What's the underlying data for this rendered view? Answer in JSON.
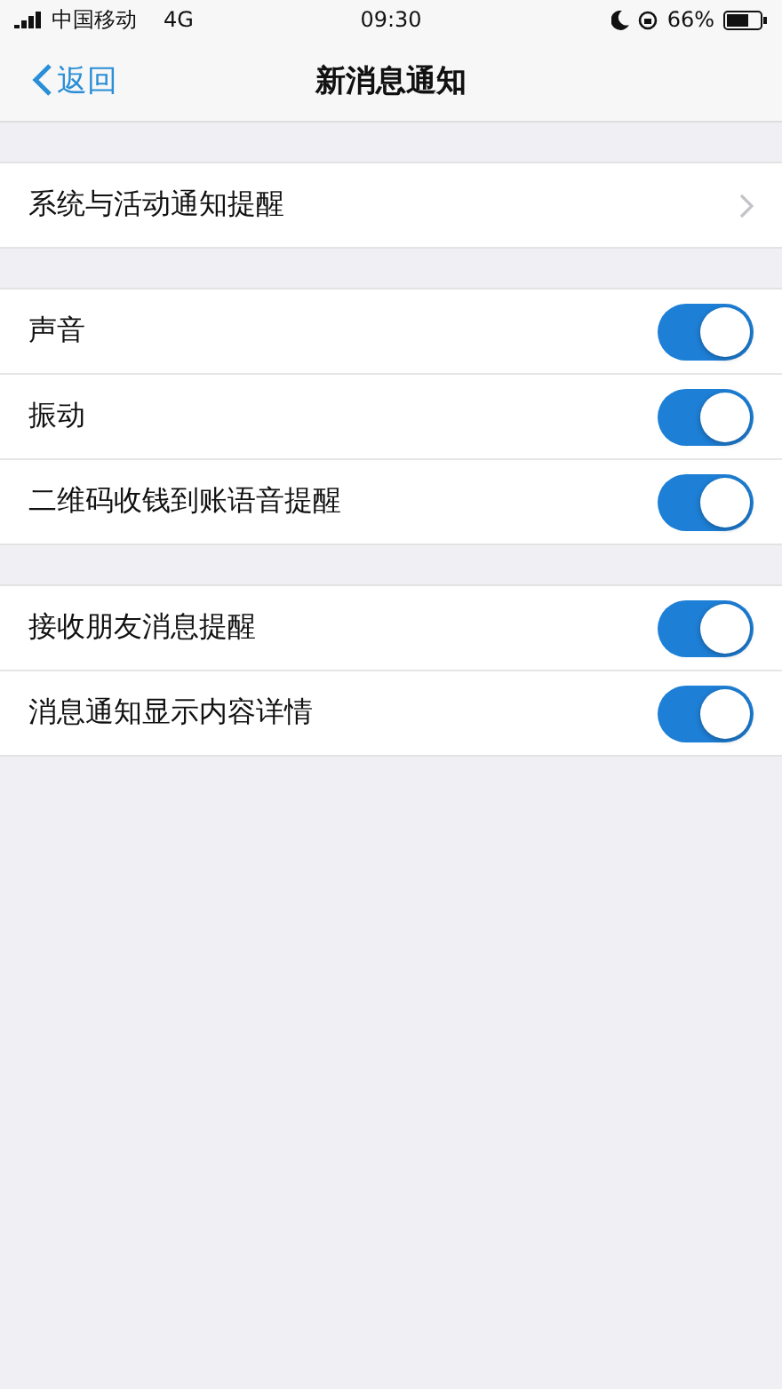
{
  "status_bar": {
    "carrier": "中国移动",
    "network": "4G",
    "time": "09:30",
    "battery": "66%"
  },
  "nav": {
    "back": "返回",
    "title": "新消息通知"
  },
  "groups": [
    {
      "rows": [
        {
          "kind": "link",
          "label": "系统与活动通知提醒"
        }
      ]
    },
    {
      "rows": [
        {
          "kind": "toggle",
          "label": "声音",
          "on": true
        },
        {
          "kind": "toggle",
          "label": "振动",
          "on": true
        },
        {
          "kind": "toggle",
          "label": "二维码收钱到账语音提醒",
          "on": true
        }
      ]
    },
    {
      "rows": [
        {
          "kind": "toggle",
          "label": "接收朋友消息提醒",
          "on": true
        },
        {
          "kind": "toggle",
          "label": "消息通知显示内容详情",
          "on": true
        }
      ]
    }
  ]
}
